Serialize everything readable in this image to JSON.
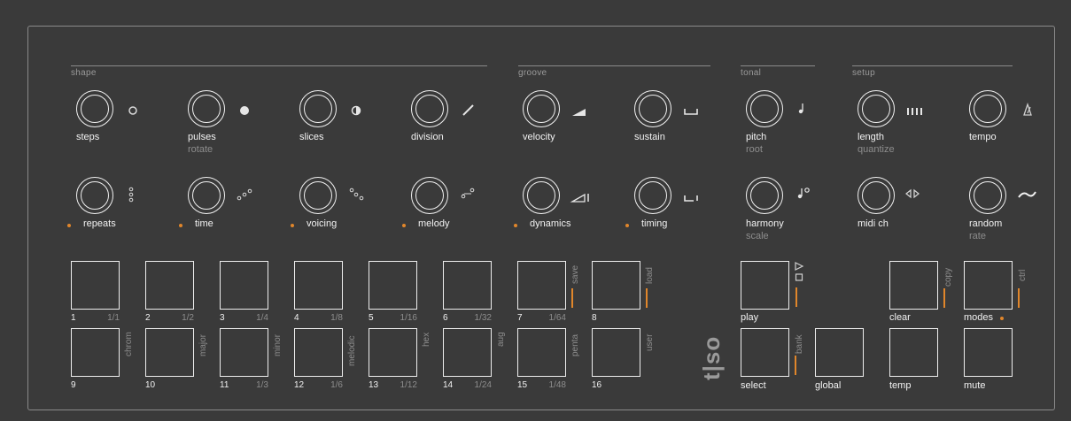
{
  "colors": {
    "background": "#3a3a3a",
    "accent": "#e0862b",
    "text": "#f2f2f2",
    "muted": "#8d8d8d"
  },
  "sections": {
    "shape": "shape",
    "groove": "groove",
    "tonal": "tonal",
    "setup": "setup"
  },
  "knobs_top": [
    {
      "label": "steps",
      "sub": "",
      "icon": "circle-outline-icon"
    },
    {
      "label": "pulses",
      "sub": "rotate",
      "icon": "circle-filled-icon"
    },
    {
      "label": "slices",
      "sub": "",
      "icon": "half-circle-icon"
    },
    {
      "label": "division",
      "sub": "",
      "icon": "slash-icon"
    },
    {
      "label": "velocity",
      "sub": "",
      "icon": "ramp-filled-icon"
    },
    {
      "label": "sustain",
      "sub": "",
      "icon": "bracket-icon"
    },
    {
      "label": "pitch",
      "sub": "root",
      "icon": "note-icon"
    },
    {
      "label": "length",
      "sub": "quantize",
      "icon": "bars-icon"
    },
    {
      "label": "tempo",
      "sub": "",
      "icon": "metronome-icon"
    }
  ],
  "knobs_bottom": [
    {
      "label": "repeats",
      "sub": "",
      "icon": "three-dots-icon",
      "dot": true
    },
    {
      "label": "time",
      "sub": "",
      "icon": "diagonal-dots-icon",
      "dot": true
    },
    {
      "label": "voicing",
      "sub": "",
      "icon": "scatter-dots-icon",
      "dot": true
    },
    {
      "label": "melody",
      "sub": "",
      "icon": "melody-icon",
      "dot": true
    },
    {
      "label": "dynamics",
      "sub": "",
      "icon": "ramp-outline-icon",
      "dot": true
    },
    {
      "label": "timing",
      "sub": "",
      "icon": "timing-bracket-icon",
      "dot": true
    },
    {
      "label": "harmony",
      "sub": "scale",
      "icon": "harmony-note-icon",
      "dot": false
    },
    {
      "label": "midi ch",
      "sub": "",
      "icon": "arrows-lr-icon",
      "dot": false
    },
    {
      "label": "random",
      "sub": "rate",
      "icon": "wave-icon",
      "dot": false
    }
  ],
  "pads_top": [
    {
      "num": "1",
      "frac": "1/1",
      "side": ""
    },
    {
      "num": "2",
      "frac": "1/2",
      "side": ""
    },
    {
      "num": "3",
      "frac": "1/4",
      "side": ""
    },
    {
      "num": "4",
      "frac": "1/8",
      "side": ""
    },
    {
      "num": "5",
      "frac": "1/16",
      "side": ""
    },
    {
      "num": "6",
      "frac": "1/32",
      "side": ""
    },
    {
      "num": "7",
      "frac": "1/64",
      "side": "save"
    },
    {
      "num": "8",
      "frac": "",
      "side": "load"
    }
  ],
  "pads_bottom": [
    {
      "num": "9",
      "frac": "",
      "side": "chrom"
    },
    {
      "num": "10",
      "frac": "",
      "side": "major"
    },
    {
      "num": "11",
      "frac": "1/3",
      "side": "minor"
    },
    {
      "num": "12",
      "frac": "1/6",
      "side": "melodic"
    },
    {
      "num": "13",
      "frac": "1/12",
      "side": "hex"
    },
    {
      "num": "14",
      "frac": "1/24",
      "side": "aug"
    },
    {
      "num": "15",
      "frac": "1/48",
      "side": "penta"
    },
    {
      "num": "16",
      "frac": "",
      "side": "user"
    }
  ],
  "buttons": {
    "play": "play",
    "clear": "clear",
    "copy": "copy",
    "modes": "modes",
    "ctrl": "ctrl",
    "select": "select",
    "bank": "bank",
    "global": "global",
    "temp": "temp",
    "mute": "mute"
  },
  "logo": "t|so"
}
